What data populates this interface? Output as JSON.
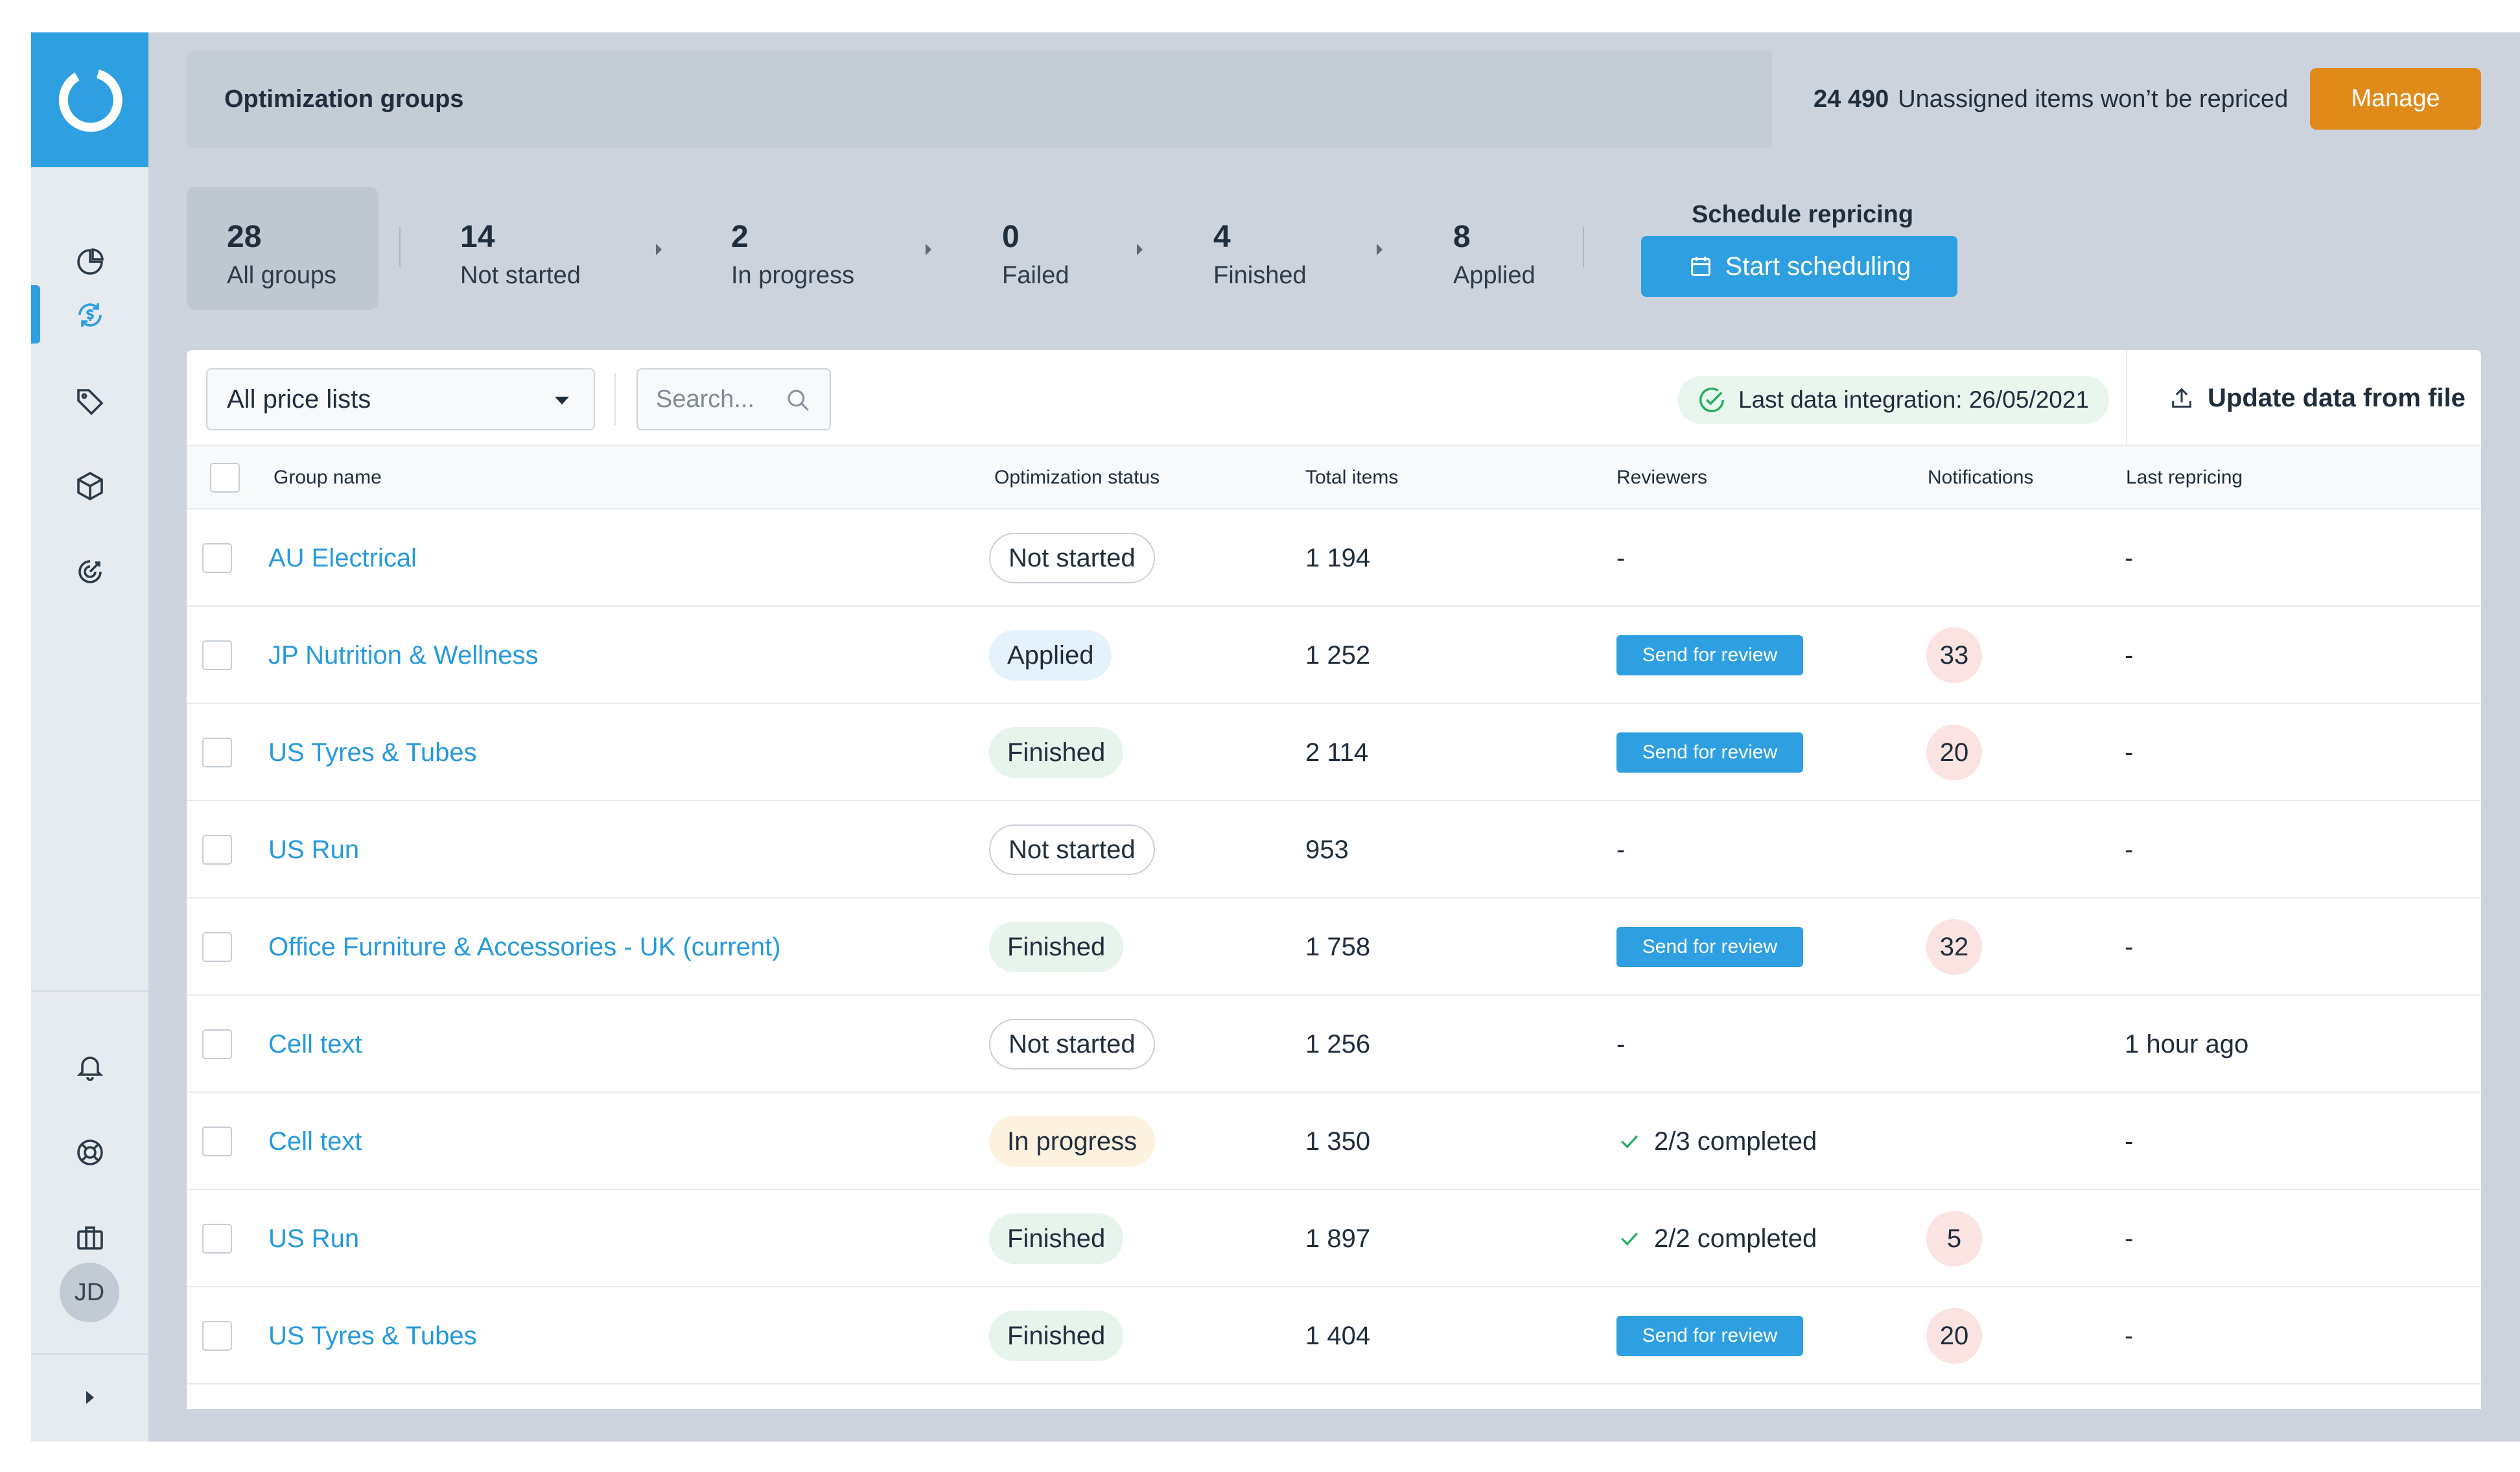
{
  "sidebar": {
    "logo": "logo-icon",
    "items": [
      {
        "icon": "pie-chart-icon"
      },
      {
        "icon": "dollar-refresh-icon",
        "active": true
      },
      {
        "icon": "tag-icon"
      },
      {
        "icon": "cube-icon"
      },
      {
        "icon": "target-icon"
      }
    ],
    "bottom_items": [
      {
        "icon": "bell-icon"
      },
      {
        "icon": "lifebuoy-icon"
      },
      {
        "icon": "briefcase-icon"
      }
    ],
    "avatar_initials": "JD",
    "expand_icon": "expand-arrow-icon"
  },
  "header": {
    "title": "Optimization groups",
    "unassigned_count": "24 490",
    "unassigned_text": "Unassigned items won’t be repriced",
    "manage_label": "Manage"
  },
  "stats": [
    {
      "value": "28",
      "label": "All groups"
    },
    {
      "value": "14",
      "label": "Not started"
    },
    {
      "value": "2",
      "label": "In progress"
    },
    {
      "value": "0",
      "label": "Failed"
    },
    {
      "value": "4",
      "label": "Finished"
    },
    {
      "value": "8",
      "label": "Applied"
    }
  ],
  "schedule": {
    "title": "Schedule repricing",
    "button_label": "Start scheduling"
  },
  "toolbar": {
    "price_list_selected": "All price lists",
    "search_placeholder": "Search...",
    "integration_text": "Last data integration: 26/05/2021",
    "update_label": "Update data from file"
  },
  "table": {
    "columns": [
      "Group name",
      "Optimization status",
      "Total items",
      "Reviewers",
      "Notifications",
      "Last repricing"
    ],
    "rows": [
      {
        "name": "AU Electrical",
        "status": "Not started",
        "total": "1 194",
        "reviewers": "-",
        "notifications": "",
        "last": "-"
      },
      {
        "name": "JP Nutrition & Wellness",
        "status": "Applied",
        "total": "1 252",
        "reviewers": "Send for review",
        "notifications": "33",
        "last": "-"
      },
      {
        "name": "US Tyres & Tubes",
        "status": "Finished",
        "total": "2 114",
        "reviewers": "Send for review",
        "notifications": "20",
        "last": "-"
      },
      {
        "name": "US Run",
        "status": "Not started",
        "total": "953",
        "reviewers": "-",
        "notifications": "",
        "last": "-"
      },
      {
        "name": "Office Furniture & Accessories - UK (current)",
        "status": "Finished",
        "total": "1 758",
        "reviewers": "Send for review",
        "notifications": "32",
        "last": "-"
      },
      {
        "name": "Cell text",
        "status": "Not started",
        "total": "1 256",
        "reviewers": "-",
        "notifications": "",
        "last": "1 hour ago"
      },
      {
        "name": "Cell text",
        "status": "In progress",
        "total": "1 350",
        "reviewers": "2/3 completed",
        "notifications": "",
        "last": "-"
      },
      {
        "name": "US Run",
        "status": "Finished",
        "total": "1 897",
        "reviewers": "2/2 completed",
        "notifications": "5",
        "last": "-"
      },
      {
        "name": "US Tyres & Tubes",
        "status": "Finished",
        "total": "1 404",
        "reviewers": "Send for review",
        "notifications": "20",
        "last": "-"
      }
    ]
  },
  "colors": {
    "accent": "#2e9fe0",
    "manage": "#e08a19",
    "link": "#2699dc",
    "notification_bg": "#fbe3e1",
    "integration_bg": "#e8f6ee",
    "check_green": "#27ae60"
  }
}
